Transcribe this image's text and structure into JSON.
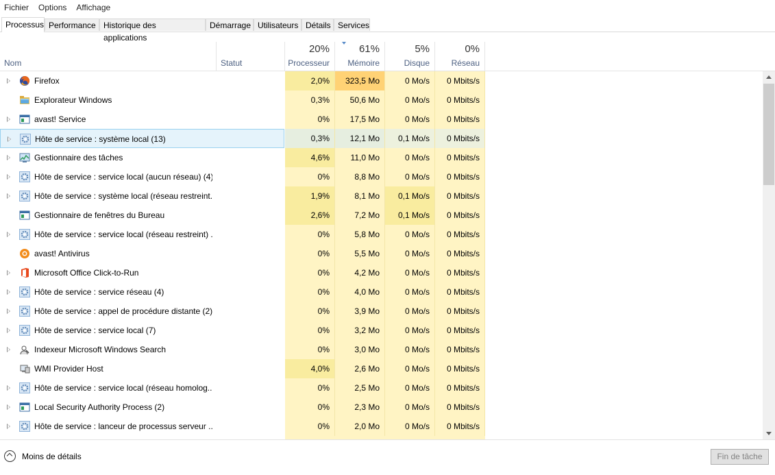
{
  "menu": [
    "Fichier",
    "Options",
    "Affichage"
  ],
  "tabs": [
    "Processus",
    "Performance",
    "Historique des applications",
    "Démarrage",
    "Utilisateurs",
    "Détails",
    "Services"
  ],
  "columns": {
    "name": "Nom",
    "status": "Statut",
    "cpu": {
      "pct": "20%",
      "label": "Processeur"
    },
    "memory": {
      "pct": "61%",
      "label": "Mémoire"
    },
    "disk": {
      "pct": "5%",
      "label": "Disque"
    },
    "network": {
      "pct": "0%",
      "label": "Réseau"
    }
  },
  "colors": {
    "heat_light": "#fff4c4",
    "heat_mid": "#f9ec9f",
    "heat_hot": "#ffd275",
    "selection": "#e5f3fb"
  },
  "processes": [
    {
      "name": "Firefox",
      "icon": "firefox-icon",
      "expandable": true,
      "cpu": "2,0%",
      "mem": "323,5 Mo",
      "disk": "0 Mo/s",
      "net": "0 Mbits/s"
    },
    {
      "name": "Explorateur Windows",
      "icon": "folder-icon",
      "expandable": false,
      "cpu": "0,3%",
      "mem": "50,6 Mo",
      "disk": "0 Mo/s",
      "net": "0 Mbits/s"
    },
    {
      "name": "avast! Service",
      "icon": "window-app-icon",
      "expandable": true,
      "cpu": "0%",
      "mem": "17,5 Mo",
      "disk": "0 Mo/s",
      "net": "0 Mbits/s"
    },
    {
      "name": "Hôte de service : système local (13)",
      "icon": "gear-icon",
      "expandable": true,
      "cpu": "0,3%",
      "mem": "12,1 Mo",
      "disk": "0,1 Mo/s",
      "net": "0 Mbits/s",
      "selected": true
    },
    {
      "name": "Gestionnaire des tâches",
      "icon": "task-manager-icon",
      "expandable": true,
      "cpu": "4,6%",
      "mem": "11,0 Mo",
      "disk": "0 Mo/s",
      "net": "0 Mbits/s"
    },
    {
      "name": "Hôte de service : service local (aucun réseau) (4)",
      "icon": "gear-icon",
      "expandable": true,
      "cpu": "0%",
      "mem": "8,8 Mo",
      "disk": "0 Mo/s",
      "net": "0 Mbits/s"
    },
    {
      "name": "Hôte de service : système local (réseau restreint...",
      "icon": "gear-icon",
      "expandable": true,
      "cpu": "1,9%",
      "mem": "8,1 Mo",
      "disk": "0,1 Mo/s",
      "net": "0 Mbits/s"
    },
    {
      "name": "Gestionnaire de fenêtres du Bureau",
      "icon": "window-app-icon",
      "expandable": false,
      "cpu": "2,6%",
      "mem": "7,2 Mo",
      "disk": "0,1 Mo/s",
      "net": "0 Mbits/s"
    },
    {
      "name": "Hôte de service : service local (réseau restreint) ...",
      "icon": "gear-icon",
      "expandable": true,
      "cpu": "0%",
      "mem": "5,8 Mo",
      "disk": "0 Mo/s",
      "net": "0 Mbits/s"
    },
    {
      "name": "avast! Antivirus",
      "icon": "avast-icon",
      "expandable": false,
      "cpu": "0%",
      "mem": "5,5 Mo",
      "disk": "0 Mo/s",
      "net": "0 Mbits/s"
    },
    {
      "name": "Microsoft Office Click-to-Run",
      "icon": "office-icon",
      "expandable": true,
      "cpu": "0%",
      "mem": "4,2 Mo",
      "disk": "0 Mo/s",
      "net": "0 Mbits/s"
    },
    {
      "name": "Hôte de service : service réseau (4)",
      "icon": "gear-icon",
      "expandable": true,
      "cpu": "0%",
      "mem": "4,0 Mo",
      "disk": "0 Mo/s",
      "net": "0 Mbits/s"
    },
    {
      "name": "Hôte de service : appel de procédure distante (2)",
      "icon": "gear-icon",
      "expandable": true,
      "cpu": "0%",
      "mem": "3,9 Mo",
      "disk": "0 Mo/s",
      "net": "0 Mbits/s"
    },
    {
      "name": "Hôte de service : service local (7)",
      "icon": "gear-icon",
      "expandable": true,
      "cpu": "0%",
      "mem": "3,2 Mo",
      "disk": "0 Mo/s",
      "net": "0 Mbits/s"
    },
    {
      "name": "Indexeur Microsoft Windows Search",
      "icon": "search-indexer-icon",
      "expandable": true,
      "cpu": "0%",
      "mem": "3,0 Mo",
      "disk": "0 Mo/s",
      "net": "0 Mbits/s"
    },
    {
      "name": "WMI Provider Host",
      "icon": "wmi-icon",
      "expandable": false,
      "cpu": "4,0%",
      "mem": "2,6 Mo",
      "disk": "0 Mo/s",
      "net": "0 Mbits/s"
    },
    {
      "name": "Hôte de service : service local (réseau homolog...",
      "icon": "gear-icon",
      "expandable": true,
      "cpu": "0%",
      "mem": "2,5 Mo",
      "disk": "0 Mo/s",
      "net": "0 Mbits/s"
    },
    {
      "name": "Local Security Authority Process (2)",
      "icon": "window-app-icon",
      "expandable": true,
      "cpu": "0%",
      "mem": "2,3 Mo",
      "disk": "0 Mo/s",
      "net": "0 Mbits/s"
    },
    {
      "name": "Hôte de service : lanceur de processus serveur ...",
      "icon": "gear-icon",
      "expandable": true,
      "cpu": "0%",
      "mem": "2,0 Mo",
      "disk": "0 Mo/s",
      "net": "0 Mbits/s"
    }
  ],
  "footer": {
    "fewer_details": "Moins de détails",
    "end_task": "Fin de tâche"
  }
}
